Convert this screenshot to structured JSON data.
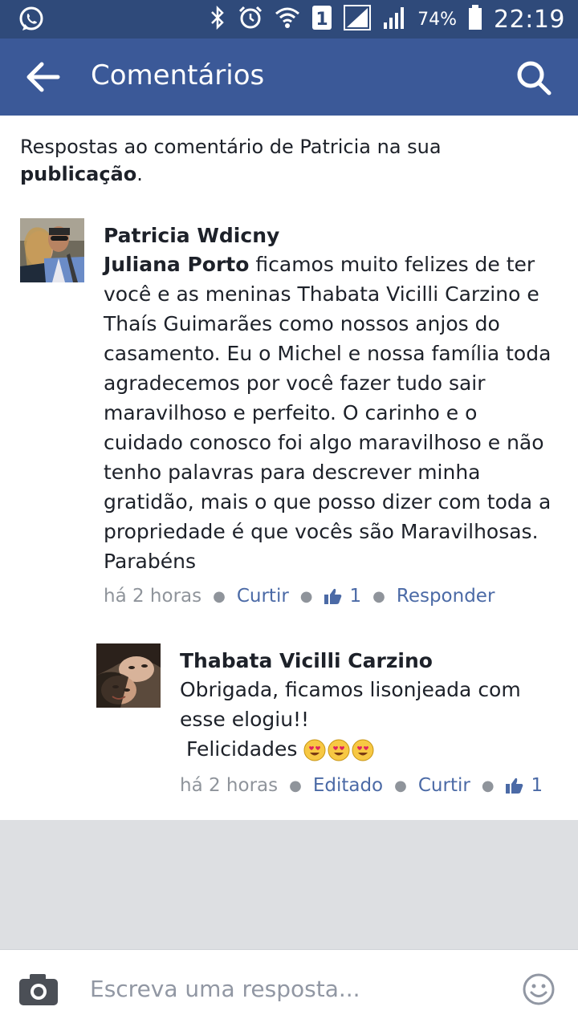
{
  "status_bar": {
    "battery_percent": "74%",
    "time": "22:19",
    "sim_label": "1",
    "icons": [
      "whatsapp-icon",
      "bluetooth-icon",
      "alarm-icon",
      "wifi-icon",
      "sim-icon",
      "signal-icon",
      "signal-icon",
      "battery-icon"
    ]
  },
  "app_bar": {
    "title": "Comentários",
    "background": "#3b5998"
  },
  "intro": {
    "text": "Respostas ao comentário de Patricia na sua ",
    "link": "publicação",
    "suffix": "."
  },
  "comments": [
    {
      "author": "Patricia Wdicny",
      "mention": "Juliana Porto",
      "text": " ficamos muito felizes de ter você e as meninas  Thabata Vicilli Carzino e Thaís Guimarães como nossos anjos do casamento. Eu o Michel e nossa família toda agradecemos por  você fazer tudo sair maravilhoso e perfeito. O carinho e o cuidado conosco foi algo maravilhoso e não tenho palavras para descrever minha gratidão, mais o que posso dizer com toda a propriedade é que vocês são Maravilhosas. Parabéns",
      "time": "há 2 horas",
      "like_label": "Curtir",
      "like_count": "1",
      "reply_label": "Responder"
    },
    {
      "author": "Thabata Vicilli Carzino",
      "text_line1": "Obrigada, ficamos lisonjeada com esse elogiu!!",
      "text_line2": " Felicidades",
      "emoji": [
        "heart-eyes-emoji",
        "heart-eyes-emoji",
        "heart-eyes-emoji"
      ],
      "time": "há 2 horas",
      "edited_label": "Editado",
      "like_label": "Curtir",
      "like_count": "1"
    }
  ],
  "reply_bar": {
    "placeholder": "Escreva uma resposta..."
  },
  "colors": {
    "status_bar": "#2f4a7a",
    "app_bar": "#3b5998",
    "link": "#4b6aa6",
    "meta": "#8f949b",
    "gray_area": "#dddfe2"
  }
}
